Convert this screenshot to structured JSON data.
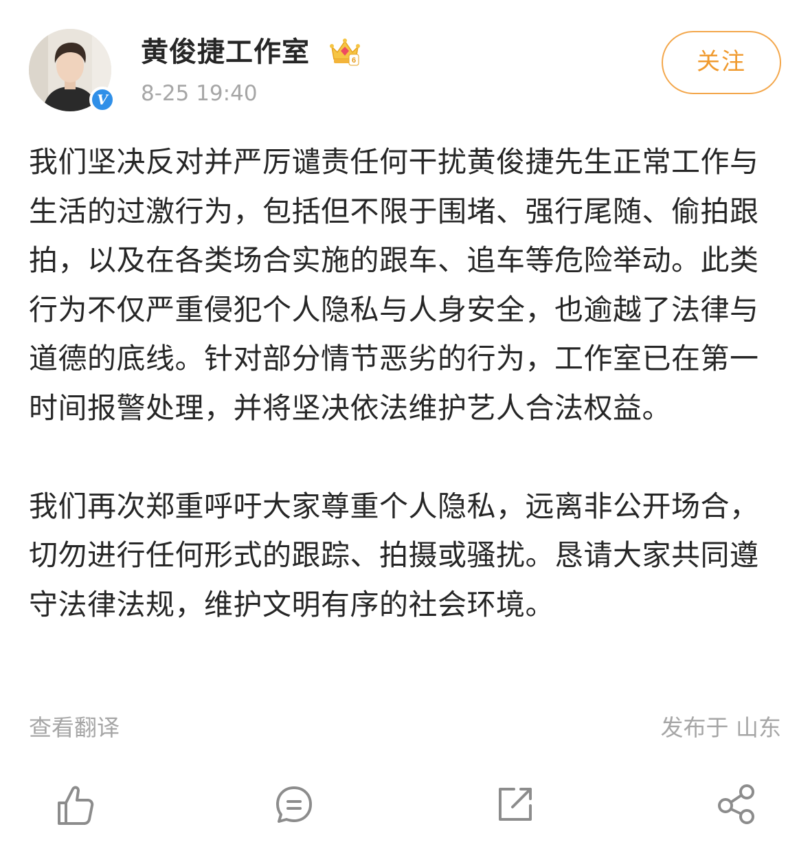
{
  "account": {
    "name": "黄俊捷工作室",
    "timestamp": "8-25 19:40",
    "verified_mark": "V",
    "avatar_icon": "avatar-photo",
    "rank_icon": "crown-level-6-icon",
    "rank_level": "6"
  },
  "follow": {
    "label": "关注"
  },
  "post": {
    "paragraphs": [
      "我们坚决反对并严厉谴责任何干扰黄俊捷先生正常工作与生活的过激行为，包括但不限于围堵、强行尾随、偷拍跟拍，以及在各类场合实施的跟车、追车等危险举动。此类行为不仅严重侵犯个人隐私与人身安全，也逾越了法律与道德的底线。针对部分情节恶劣的行为，工作室已在第一时间报警处理，并将坚决依法维护艺人合法权益。",
      "我们再次郑重呼吁大家尊重个人隐私，远离非公开场合，切勿进行任何形式的跟踪、拍摄或骚扰。恳请大家共同遵守法律法规，维护文明有序的社会环境。"
    ],
    "translate_label": "查看翻译",
    "location_label": "发布于 山东"
  },
  "actions": [
    {
      "name": "like",
      "icon": "thumbs-up-icon"
    },
    {
      "name": "comment",
      "icon": "comment-icon"
    },
    {
      "name": "repost",
      "icon": "repost-icon"
    },
    {
      "name": "share",
      "icon": "share-icon"
    }
  ],
  "colors": {
    "accent": "#f09a2e",
    "muted": "#a6a6a6",
    "text": "#262626",
    "verified": "#2f8fe8",
    "icon": "#8c8c8c"
  }
}
